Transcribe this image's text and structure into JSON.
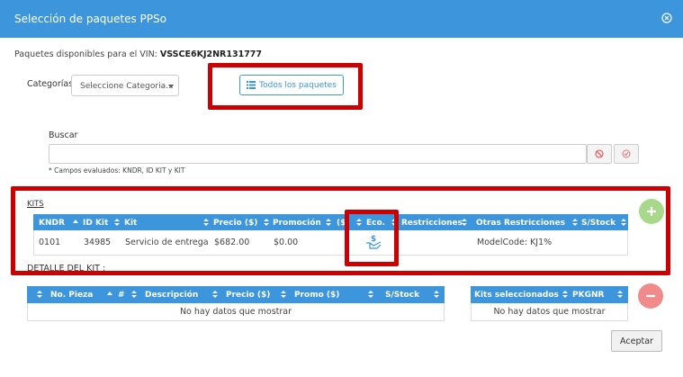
{
  "modal": {
    "title": "Selección de paquetes PPSo"
  },
  "vin": {
    "label": "Paquetes disponibles para el VIN:",
    "value": "VSSCE6KJ2NR131777"
  },
  "categorias": {
    "label": "Categorías",
    "selected": "Seleccione Categoria..."
  },
  "todos_button": {
    "label": "Todos los paquetes"
  },
  "buscar": {
    "label": "Buscar",
    "value": "",
    "note": "* Campos evaluados: KNDR, ID KIT y KIT"
  },
  "kits": {
    "title": "KITS",
    "columns": [
      "KNDR",
      "ID Kit",
      "Kit",
      "Precio ($)",
      "Promoción",
      "($",
      "Eco.",
      "Restricciones",
      "Otras Restricciones",
      "S/Stock"
    ],
    "rows": [
      {
        "kndr": "0101",
        "id_kit": "34985",
        "kit": "Servicio de entrega",
        "precio": "$682.00",
        "promocion": "$0.00",
        "eco_icon": "dollar-hand-icon",
        "restricciones": "",
        "otras": "ModelCode: KJ1%",
        "stock": ""
      }
    ]
  },
  "detalle": {
    "title": "DETALLE DEL KIT :",
    "columns": [
      "No. Pieza",
      "#",
      "Descripción",
      "Precio ($)",
      "Promo ($)",
      "S/Stock"
    ],
    "empty": "No hay datos que mostrar"
  },
  "seleccionados": {
    "columns": [
      "Kits seleccionados",
      "PKGNR"
    ],
    "empty": "No hay datos que mostrar"
  },
  "aceptar": {
    "label": "Aceptar"
  },
  "colors": {
    "header_blue": "#3d95dc",
    "highlight_red": "#cc0000",
    "add_green": "#a8d98a",
    "remove_red": "#f18a8a"
  }
}
